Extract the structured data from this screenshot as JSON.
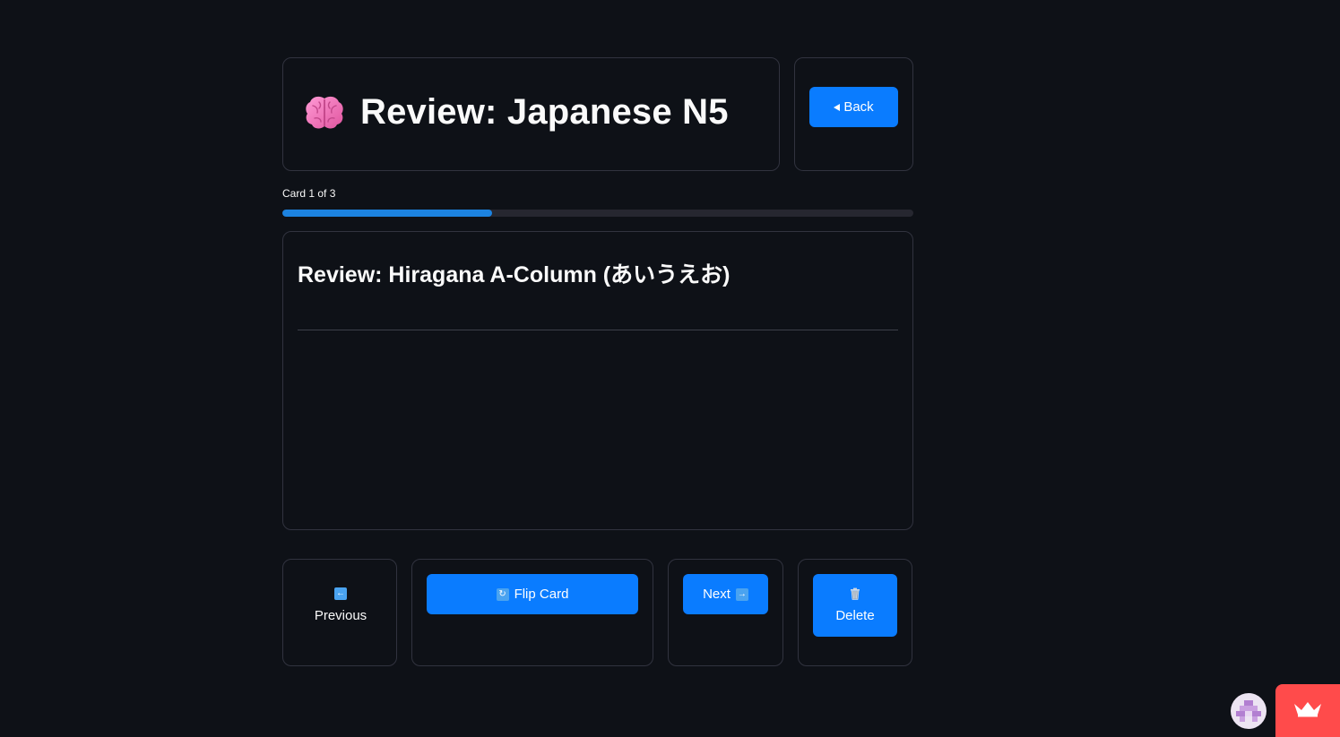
{
  "header": {
    "icon": "brain-icon",
    "title": "Review: Japanese N5"
  },
  "back_button": {
    "icon": "triangle-left-icon",
    "label": "Back"
  },
  "progress": {
    "label": "Card 1 of 3",
    "value": 0.333
  },
  "card": {
    "title": "Review: Hiragana A-Column (あいうえお)"
  },
  "nav": {
    "previous": {
      "icon": "left-arrow-icon",
      "label": "Previous"
    },
    "flip": {
      "icon": "flip-arrows-icon",
      "label": "Flip Card"
    },
    "next": {
      "icon": "right-arrow-icon",
      "label": "Next"
    },
    "delete": {
      "icon": "trash-icon",
      "label": "Delete"
    }
  },
  "colors": {
    "background": "#0e1117",
    "primary": "#0a7cff",
    "progress": "#1c83e1",
    "badge": "#ff4b4b"
  }
}
